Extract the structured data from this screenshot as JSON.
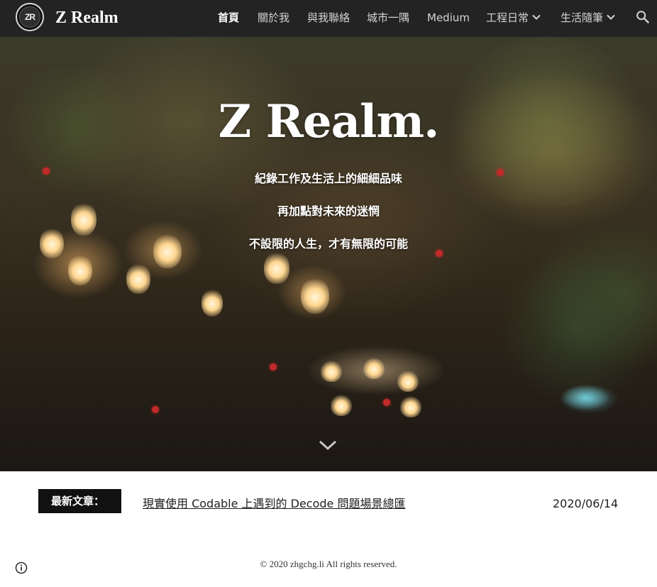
{
  "header": {
    "logo_text": "ZR",
    "site_title": "Z Realm",
    "nav": [
      {
        "label": "首頁",
        "active": true
      },
      {
        "label": "關於我"
      },
      {
        "label": "與我聯絡"
      },
      {
        "label": "城市一隅"
      },
      {
        "label": "Medium"
      },
      {
        "label": "工程日常",
        "has_dropdown": true
      },
      {
        "label": "生活隨筆",
        "has_dropdown": true
      }
    ],
    "search_icon": "search-icon"
  },
  "hero": {
    "title": "Z Realm.",
    "lines": [
      "紀錄工作及生活上的細細品味",
      "再加點對未來的迷惘",
      "不設限的人生，才有無限的可能"
    ],
    "scroll_icon": "chevron-down-icon"
  },
  "latest": {
    "label": "最新文章：",
    "title": "現實使用 Codable 上遇到的 Decode 問題場景總匯 ",
    "date": "2020/06/14"
  },
  "footer": {
    "copyright": "© 2020 zhgchg.li All rights reserved.",
    "info_icon": "info-icon"
  },
  "colors": {
    "header_bg": "#232323",
    "label_bg": "#111111",
    "text": "#212121"
  }
}
